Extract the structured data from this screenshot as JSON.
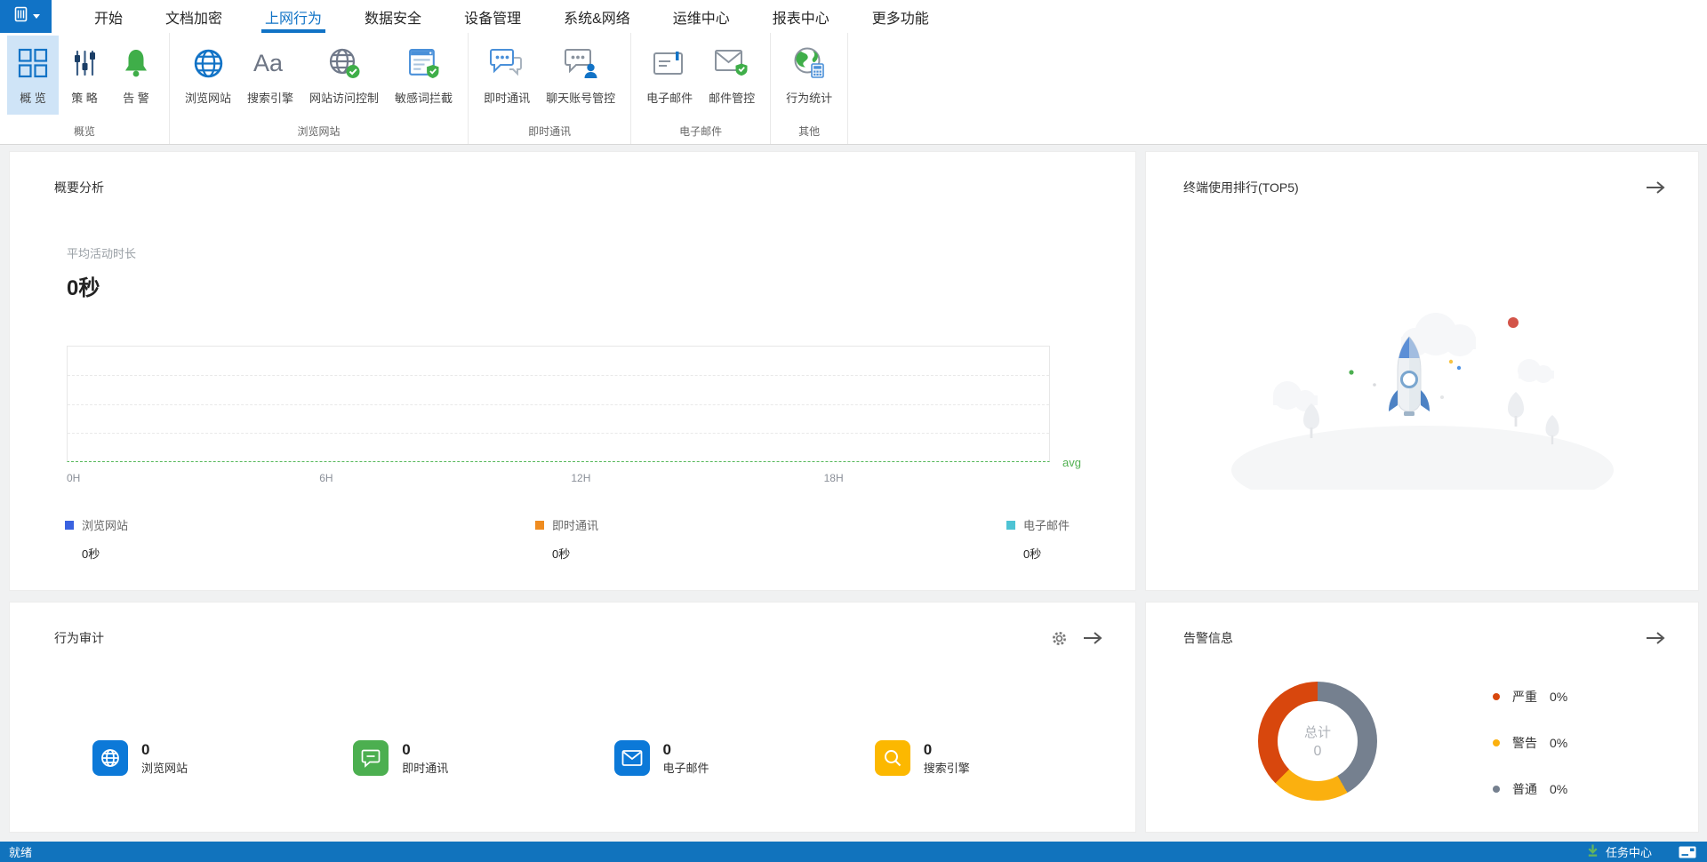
{
  "menubar": {
    "items": [
      "开始",
      "文档加密",
      "上网行为",
      "数据安全",
      "设备管理",
      "系统&网络",
      "运维中心",
      "报表中心",
      "更多功能"
    ],
    "active": "上网行为"
  },
  "ribbon": {
    "groups": [
      {
        "label": "概览",
        "items": [
          {
            "label": "概 览",
            "selected": true
          },
          {
            "label": "策 略"
          },
          {
            "label": "告 警"
          }
        ]
      },
      {
        "label": "浏览网站",
        "items": [
          {
            "label": "浏览网站"
          },
          {
            "label": "搜索引擎"
          },
          {
            "label": "网站访问控制"
          },
          {
            "label": "敏感词拦截"
          }
        ]
      },
      {
        "label": "即时通讯",
        "items": [
          {
            "label": "即时通讯"
          },
          {
            "label": "聊天账号管控"
          }
        ]
      },
      {
        "label": "电子邮件",
        "items": [
          {
            "label": "电子邮件"
          },
          {
            "label": "邮件管控"
          }
        ]
      },
      {
        "label": "其他",
        "items": [
          {
            "label": "行为统计"
          }
        ]
      }
    ]
  },
  "summary_card": {
    "title": "概要分析",
    "metric_label": "平均活动时长",
    "metric_value": "0秒"
  },
  "ranking_card": {
    "title": "终端使用排行(TOP5)",
    "empty": true
  },
  "audit_card": {
    "title": "行为审计",
    "stats": [
      {
        "value": "0",
        "label": "浏览网站",
        "color": "#0c79d8"
      },
      {
        "value": "0",
        "label": "即时通讯",
        "color": "#4caf50"
      },
      {
        "value": "0",
        "label": "电子邮件",
        "color": "#0c79d8"
      },
      {
        "value": "0",
        "label": "搜索引擎",
        "color": "#fcb800"
      }
    ]
  },
  "alarm_card": {
    "title": "告警信息"
  },
  "statusbar": {
    "ready": "就绪",
    "task_center": "任务中心"
  },
  "colors": {
    "accent_blue": "#1173c6",
    "ribbon_selected_bg": "#cfe4f7",
    "statusbar_blue": "#1173bd",
    "avg_green": "#56b85a"
  },
  "chart_data": [
    {
      "id": "avg_activity_by_hour",
      "type": "line",
      "title": "平均活动时长",
      "x_ticks": [
        "0H",
        "6H",
        "12H",
        "18H"
      ],
      "x_range_hours": [
        0,
        24
      ],
      "grid": true,
      "series": [
        {
          "name": "浏览网站",
          "color": "#3a62e0",
          "display_total": "0秒",
          "values": [
            0
          ]
        },
        {
          "name": "即时通讯",
          "color": "#ef8c20",
          "display_total": "0秒",
          "values": [
            0
          ]
        },
        {
          "name": "电子邮件",
          "color": "#4ec3d4",
          "display_total": "0秒",
          "values": [
            0
          ]
        }
      ],
      "avg_line": {
        "label": "avg",
        "value": 0,
        "color": "#56b85a"
      }
    },
    {
      "id": "alarm_distribution",
      "type": "pie",
      "title": "告警信息",
      "center_label": "总计",
      "center_value": "0",
      "slices": [
        {
          "name": "严重",
          "pct": "0%",
          "color": "#d8470d",
          "sweep_deg": 135
        },
        {
          "name": "警告",
          "pct": "0%",
          "color": "#fbb00f",
          "sweep_deg": 75
        },
        {
          "name": "普通",
          "pct": "0%",
          "color": "#75808f",
          "sweep_deg": 150
        }
      ]
    }
  ]
}
